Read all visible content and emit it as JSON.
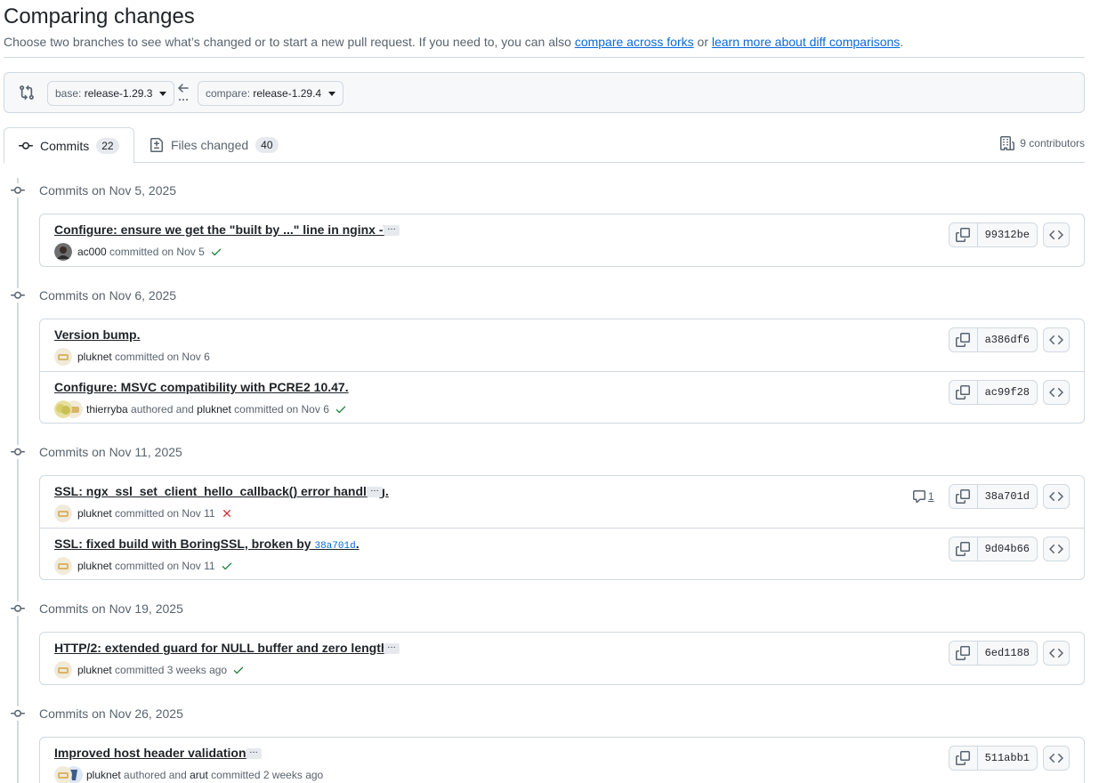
{
  "header": {
    "title": "Comparing changes",
    "description_prefix": "Choose two branches to see what’s changed or to start a new pull request. If you need to, you can also",
    "compare_forks_link": "compare across forks",
    "description_mid": "or",
    "learn_more_link": "learn more about diff comparisons",
    "description_suffix": "."
  },
  "range": {
    "base_label": "base:",
    "base_value": "release-1.29.3",
    "compare_label": "compare:",
    "compare_value": "release-1.29.4",
    "swap_dots": "..."
  },
  "tabs": [
    {
      "label": "Commits",
      "count": "22",
      "selected": true,
      "icon": "git-commit-icon"
    },
    {
      "label": "Files changed",
      "count": "40",
      "selected": false,
      "icon": "file-diff-icon"
    }
  ],
  "contributors": {
    "text": "9 contributors",
    "icon": "organization-icon"
  },
  "colors": {
    "success": "#1a7f37",
    "danger": "#d1242f",
    "link": "#0969da",
    "border": "#d1d9e0"
  },
  "groups": [
    {
      "title": "Commits on Nov 5, 2025",
      "commits": [
        {
          "message": "Configure: ensure we get the \"built by ...\" line in nginx -V.",
          "has_ellipsis": true,
          "author": "ac000",
          "verb": "committed on Nov 5",
          "status": "success",
          "sha": "99312be",
          "avatar": "dark"
        }
      ]
    },
    {
      "title": "Commits on Nov 6, 2025",
      "commits": [
        {
          "message": "Version bump.",
          "has_ellipsis": false,
          "author": "pluknet",
          "verb": "committed on Nov 6",
          "status": "none",
          "sha": "a386df6",
          "avatar": "tan"
        },
        {
          "message": "Configure: MSVC compatibility with PCRE2 10.47.",
          "has_ellipsis": false,
          "author": "thierryba",
          "mid": "authored and",
          "committer": "pluknet",
          "verb": "committed on Nov 6",
          "status": "success",
          "sha": "ac99f28",
          "avatar": "pair-yellow"
        }
      ]
    },
    {
      "title": "Commits on Nov 11, 2025",
      "commits": [
        {
          "message": "SSL: ngx_ssl_set_client_hello_callback() error handling.",
          "has_ellipsis": true,
          "author": "pluknet",
          "verb": "committed on Nov 11",
          "status": "failure",
          "sha": "38a701d",
          "comments": "1",
          "avatar": "tan"
        },
        {
          "message_prefix": "SSL: fixed build with BoringSSL, broken by",
          "message_sha": "38a701d",
          "message_suffix": ".",
          "has_ellipsis": false,
          "author": "pluknet",
          "verb": "committed on Nov 11",
          "status": "success",
          "sha": "9d04b66",
          "avatar": "tan"
        }
      ]
    },
    {
      "title": "Commits on Nov 19, 2025",
      "commits": [
        {
          "message": "HTTP/2: extended guard for NULL buffer and zero length.",
          "has_ellipsis": true,
          "author": "pluknet",
          "verb": "committed 3 weeks ago",
          "status": "success",
          "sha": "6ed1188",
          "avatar": "tan"
        }
      ]
    },
    {
      "title": "Commits on Nov 26, 2025",
      "commits": [
        {
          "message": "Improved host header validation.",
          "has_ellipsis": true,
          "author": "pluknet",
          "mid": "authored and",
          "committer": "arut",
          "verb": "committed 2 weeks ago",
          "status": "none",
          "sha": "511abb1",
          "avatar": "pair-blue"
        }
      ]
    }
  ]
}
